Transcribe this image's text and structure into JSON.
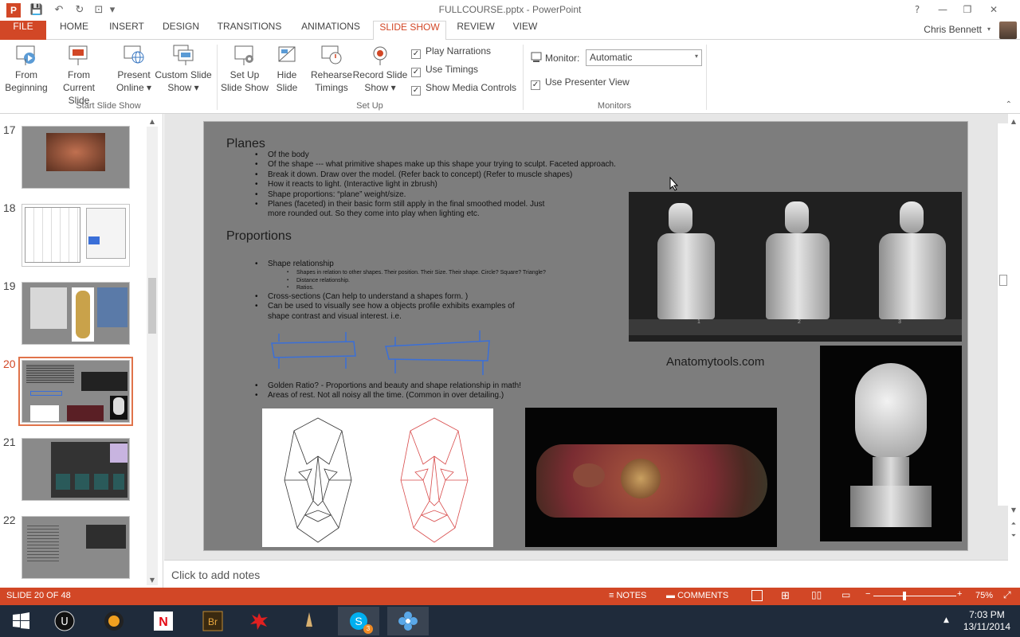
{
  "window": {
    "title": "FULLCOURSE.pptx - PowerPoint",
    "app_icon": "P",
    "controls": [
      "?",
      "—",
      "❐",
      "✕"
    ]
  },
  "qat": [
    "save-icon",
    "undo-icon",
    "redo-icon",
    "start-from-beginning-icon",
    "customize-icon"
  ],
  "tabs": [
    {
      "label": "FILE"
    },
    {
      "label": "HOME"
    },
    {
      "label": "INSERT"
    },
    {
      "label": "DESIGN"
    },
    {
      "label": "TRANSITIONS"
    },
    {
      "label": "ANIMATIONS"
    },
    {
      "label": "SLIDE SHOW"
    },
    {
      "label": "REVIEW"
    },
    {
      "label": "VIEW"
    }
  ],
  "user": {
    "name": "Chris Bennett"
  },
  "ribbon": {
    "start_group": {
      "label": "Start Slide Show",
      "from_beginning": [
        "From",
        "Beginning"
      ],
      "from_current": [
        "From",
        "Current Slide"
      ],
      "present_online": [
        "Present",
        "Online ▾"
      ],
      "custom_show": [
        "Custom Slide",
        "Show ▾"
      ]
    },
    "setup_group": {
      "label": "Set Up",
      "setup_show": [
        "Set Up",
        "Slide Show"
      ],
      "hide_slide": [
        "Hide",
        "Slide"
      ],
      "rehearse": [
        "Rehearse",
        "Timings"
      ],
      "record": [
        "Record Slide",
        "Show ▾"
      ],
      "play_narrations": "Play Narrations",
      "use_timings": "Use Timings",
      "show_media_controls": "Show Media Controls"
    },
    "monitors_group": {
      "label": "Monitors",
      "monitor_label": "Monitor:",
      "monitor_value": "Automatic",
      "use_presenter_view": "Use Presenter View"
    }
  },
  "thumbnails": [
    {
      "number": "17"
    },
    {
      "number": "18"
    },
    {
      "number": "19"
    },
    {
      "number": "20"
    },
    {
      "number": "21"
    },
    {
      "number": "22"
    }
  ],
  "slide": {
    "title_planes": "Planes",
    "planes_bullets": [
      "Of the body",
      "Of the shape --- what primitive shapes make up this shape your trying to sculpt. Faceted approach.",
      "Break it down. Draw over the model. (Refer back to concept) (Refer to muscle shapes)",
      "How it reacts to light. (Interactive light in zbrush)",
      "Shape proportions: “plane” weight/size.",
      "Planes (faceted) in their basic form still apply in the final smoothed model. Just",
      "more rounded out. So they come into play when lighting etc."
    ],
    "title_proportions": "Proportions",
    "prop_bullet_1": "Shape relationship",
    "prop_sub": [
      "Shapes in relation to other shapes. Their position. Their Size. Their shape. Circle? Square? Triangle?",
      "Distance relationship.",
      "Ratios."
    ],
    "prop_bullets_2": [
      "Cross-sections (Can help to understand a shapes form. )",
      "Can be used to visually see how a objects profile exhibits examples of",
      "shape contrast and visual interest. i.e."
    ],
    "prop_bullets_3": [
      "Golden Ratio?  - Proportions and beauty and shape relationship in math!",
      "Areas of rest. Not all noisy all the time. (Common in over detailing.)"
    ],
    "caption": "Anatomytools.com",
    "bust_labels": [
      "1",
      "2",
      "3"
    ]
  },
  "notes": {
    "placeholder": "Click to add notes"
  },
  "status": {
    "slide_info": "SLIDE 20 OF 48",
    "notes": "NOTES",
    "comments": "COMMENTS",
    "zoom_percent": "75%",
    "zoom_fraction": 0.5
  },
  "taskbar": {
    "apps": [
      "windows-start-icon",
      "unreal-engine-icon",
      "sun-app-icon",
      "netflix-icon",
      "bridge-icon",
      "splat-app-icon",
      "pencil-app-icon",
      "skype-icon",
      "flower-app-icon"
    ],
    "skype_badge": "3",
    "time": "7:03 PM",
    "date": "13/11/2014"
  },
  "colors": {
    "accent": "#d24726",
    "slide_bg": "#7d7d7d",
    "taskbar": "#1f2b3b"
  }
}
